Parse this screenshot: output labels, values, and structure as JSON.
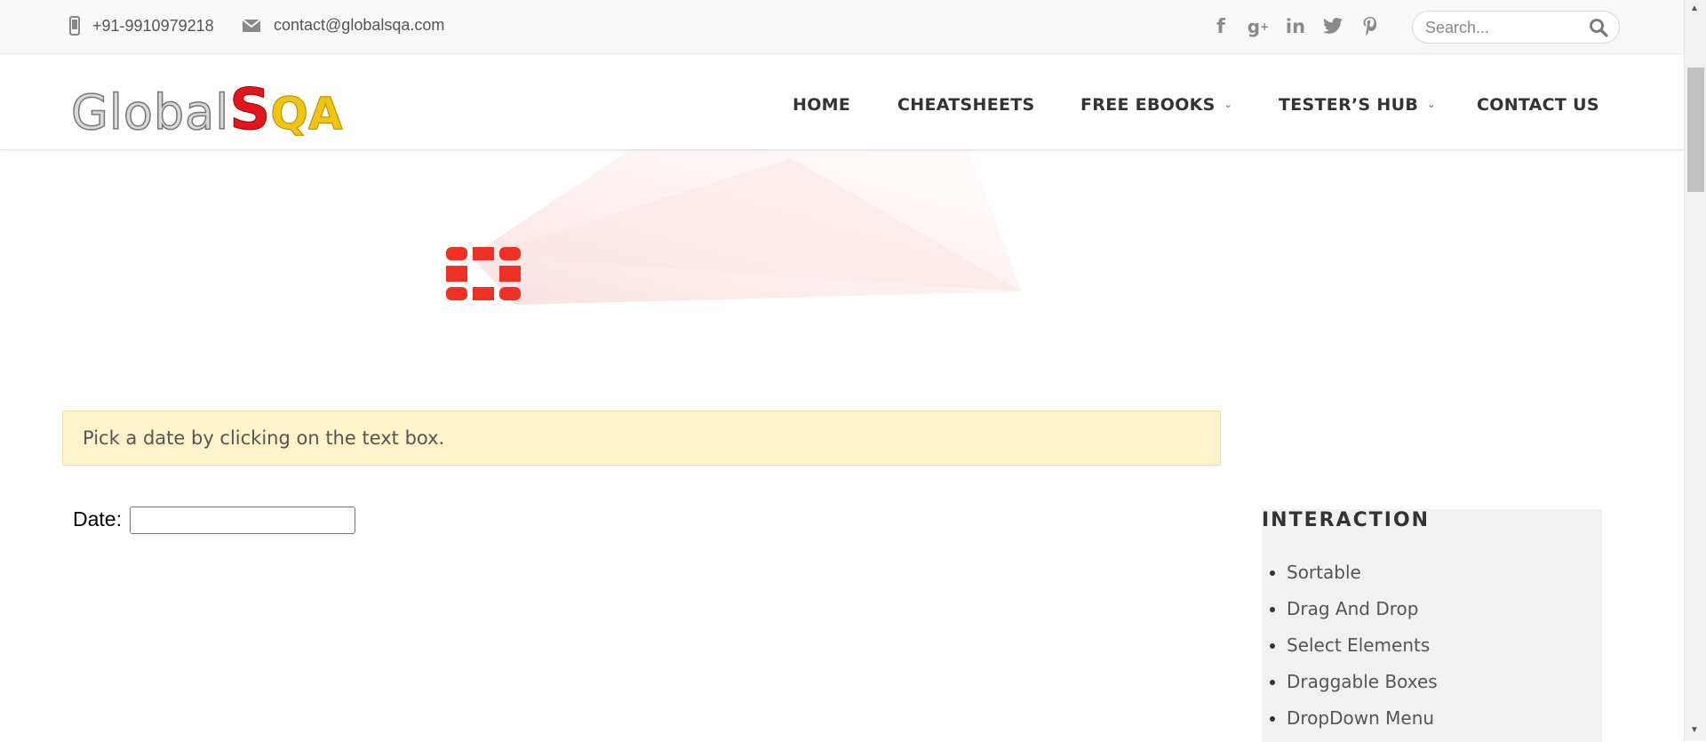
{
  "topbar": {
    "phone": "+91-9910979218",
    "email": "contact@globalsqa.com",
    "social_icons": [
      "facebook-icon",
      "google-plus-icon",
      "linkedin-icon",
      "twitter-icon",
      "pinterest-icon"
    ],
    "search_placeholder": "Search..."
  },
  "logo": {
    "part1": "Global",
    "part2": "S",
    "part3": "QA"
  },
  "nav": {
    "home": "HOME",
    "cheatsheets": "CHEATSHEETS",
    "free_ebooks": "FREE EBOOKS",
    "testers_hub": "TESTER’S HUB",
    "contact_us": "CONTACT US"
  },
  "notice": {
    "text": "Pick a date by clicking on the text box."
  },
  "date_field": {
    "label": "Date:",
    "value": ""
  },
  "sidebar": {
    "heading": "INTERACTION",
    "items": [
      "Sortable",
      "Drag And Drop",
      "Select Elements",
      "Draggable Boxes",
      "DropDown Menu"
    ]
  },
  "colors": {
    "notice_bg": "#fdf3cb",
    "logo_red": "#e1161e",
    "logo_yellow": "#f1c40f",
    "fortinet_red": "#ee3124"
  }
}
